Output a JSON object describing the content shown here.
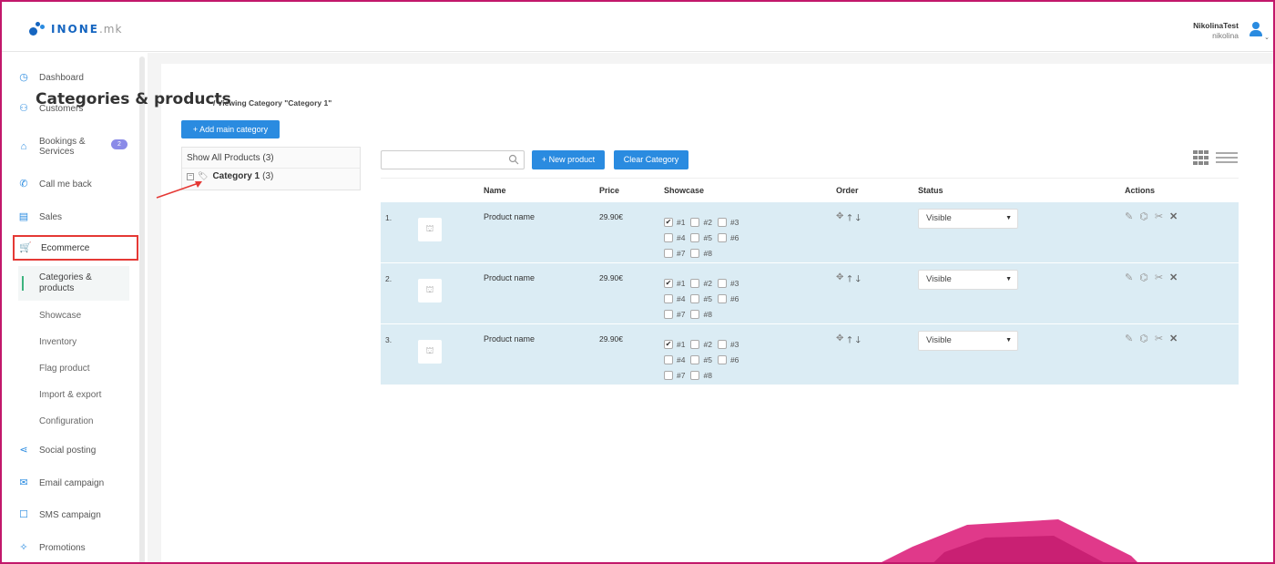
{
  "brand": {
    "name": "INONE",
    "tld": ".mk"
  },
  "user": {
    "display_name": "NikolinaTest",
    "login": "nikolina"
  },
  "sidebar": {
    "items": [
      {
        "label": "Dashboard",
        "icon": "dashboard-icon"
      },
      {
        "label": "Customers",
        "icon": "customers-icon"
      },
      {
        "label": "Bookings & Services",
        "icon": "bookings-icon",
        "badge": "2"
      },
      {
        "label": "Call me back",
        "icon": "phone-icon"
      },
      {
        "label": "Sales",
        "icon": "sales-icon"
      },
      {
        "label": "Ecommerce",
        "icon": "cart-icon"
      },
      {
        "label": "Social posting",
        "icon": "share-icon"
      },
      {
        "label": "Email campaign",
        "icon": "email-icon"
      },
      {
        "label": "SMS campaign",
        "icon": "sms-icon"
      },
      {
        "label": "Promotions",
        "icon": "promotions-icon"
      }
    ],
    "subitems": [
      {
        "label": "Categories & products",
        "active": true
      },
      {
        "label": "Showcase"
      },
      {
        "label": "Inventory"
      },
      {
        "label": "Flag product"
      },
      {
        "label": "Import & export"
      },
      {
        "label": "Configuration"
      }
    ]
  },
  "page": {
    "title": "Categories & products",
    "subtitle": "/ Viewing Category \"Category 1\"",
    "add_main_category": "+ Add main category"
  },
  "tree": {
    "show_all": "Show All Products (3)",
    "category_name": "Category 1",
    "category_count": "(3)"
  },
  "toolbar": {
    "search_placeholder": "",
    "new_product": "+ New product",
    "clear_category": "Clear Category"
  },
  "table": {
    "headers": {
      "name": "Name",
      "price": "Price",
      "showcase": "Showcase",
      "order": "Order",
      "status": "Status",
      "actions": "Actions"
    },
    "showcase_labels": [
      "#1",
      "#2",
      "#3",
      "#4",
      "#5",
      "#6",
      "#7",
      "#8"
    ],
    "rows": [
      {
        "num": "1.",
        "name": "Product name",
        "price": "29.90€",
        "showcase_checked": [
          true,
          false,
          false,
          false,
          false,
          false,
          false,
          false
        ],
        "status": "Visible"
      },
      {
        "num": "2.",
        "name": "Product name",
        "price": "29.90€",
        "showcase_checked": [
          true,
          false,
          false,
          false,
          false,
          false,
          false,
          false
        ],
        "status": "Visible"
      },
      {
        "num": "3.",
        "name": "Product name",
        "price": "29.90€",
        "showcase_checked": [
          true,
          false,
          false,
          false,
          false,
          false,
          false,
          false
        ],
        "status": "Visible"
      }
    ]
  },
  "colors": {
    "accent": "#2a8be0",
    "highlight_border": "#e53935",
    "row_bg": "#dbecf4",
    "frame": "#c2186b",
    "decor": "#e0398a"
  }
}
